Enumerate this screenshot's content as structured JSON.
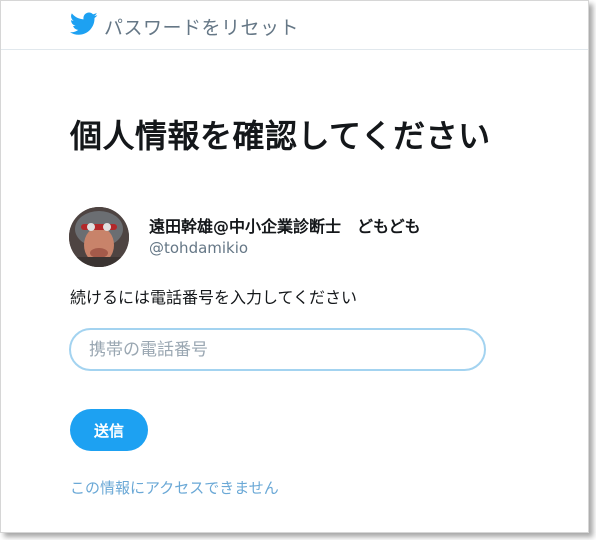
{
  "header": {
    "title": "パスワードをリセット",
    "logo_icon": "twitter-bird-icon",
    "brand_color": "#1da1f2"
  },
  "main": {
    "title": "個人情報を確認してください",
    "user": {
      "display_name": "遠田幹雄@中小企業診断士　どもども",
      "screen_name": "@tohdamikio",
      "avatar_icon": "avatar"
    },
    "instruction": "続けるには電話番号を入力してください",
    "phone_input": {
      "placeholder": "携帯の電話番号",
      "value": ""
    },
    "submit_label": "送信",
    "help_link": "この情報にアクセスできません"
  }
}
